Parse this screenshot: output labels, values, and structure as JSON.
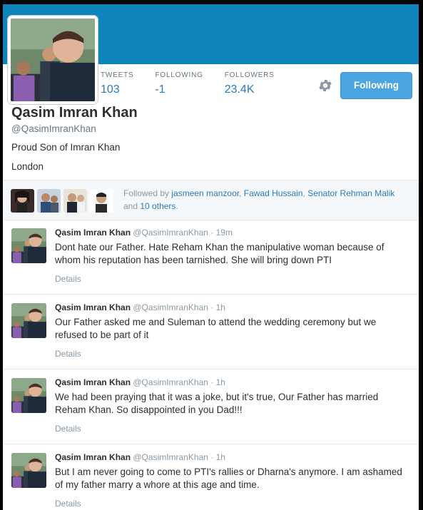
{
  "profile": {
    "name": "Qasim Imran Khan",
    "handle": "@QasimImranKhan",
    "bio": "Proud Son of Imran Khan",
    "location": "London",
    "follow_button": "Following"
  },
  "stats": [
    {
      "label": "TWEETS",
      "value": "103"
    },
    {
      "label": "FOLLOWING",
      "value": "-1"
    },
    {
      "label": "FOLLOWERS",
      "value": "23.4K"
    }
  ],
  "followed_by": {
    "prefix": "Followed by",
    "user1": "jasmeen manzoor",
    "sep1": ",",
    "user2": "Fawad Hussain",
    "sep2": ",",
    "user3": "Senator Rehman Malik",
    "conj": "and",
    "others": "10 others",
    "end": "."
  },
  "tweets": [
    {
      "name": "Qasim Imran Khan",
      "handle": "@QasimImranKhan",
      "sep": "·",
      "time": "19m",
      "text": "Dont hate our Father. Hate Reham Khan the manipulative woman because of whom his reputation has been tarnished. She will bring down PTI",
      "details": "Details"
    },
    {
      "name": "Qasim Imran Khan",
      "handle": "@QasimImranKhan",
      "sep": "·",
      "time": "1h",
      "text": "Our Father asked me and Suleman to attend the wedding ceremony but we refused to be part of it",
      "details": "Details"
    },
    {
      "name": "Qasim Imran Khan",
      "handle": "@QasimImranKhan",
      "sep": "·",
      "time": "1h",
      "text": "We had been praying that it was a joke, but it's true, Our Father has married Reham Khan. So disappointed in you Dad!!!",
      "details": "Details"
    },
    {
      "name": "Qasim Imran Khan",
      "handle": "@QasimImranKhan",
      "sep": "·",
      "time": "1h",
      "text": "But I am never going to come to PTI's rallies or Dharna's anymore. I am ashamed of my father marry a whore at this age and time.",
      "details": "Details"
    }
  ],
  "icons": {
    "settings": "gear-icon"
  },
  "colors": {
    "banner": "#0f84bc",
    "link": "#2b7bb9",
    "button": "#4ba5e3"
  }
}
